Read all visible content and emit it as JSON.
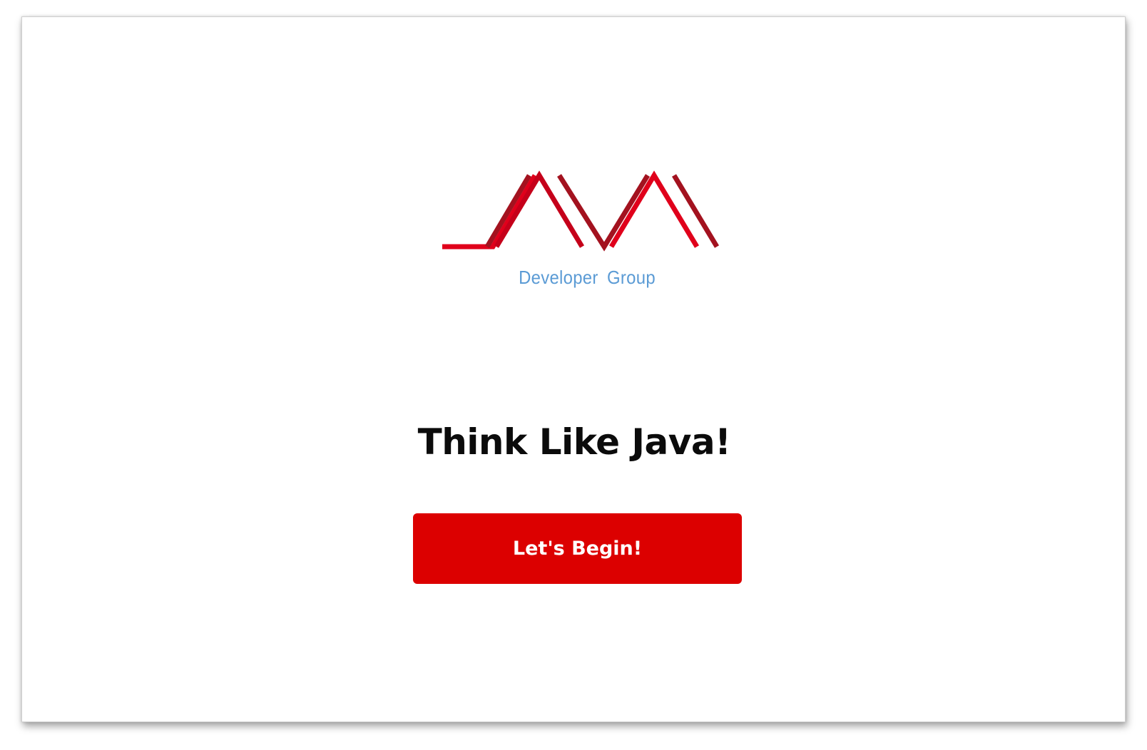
{
  "logo": {
    "wordmark": "JAVA",
    "subtitle": "Developer Group",
    "colors": {
      "red": "#e0001b",
      "dark_red": "#a3121f",
      "blue": "#5b9bd5"
    }
  },
  "main": {
    "title": "Think Like Java!",
    "cta_label": "Let's Begin!"
  },
  "theme": {
    "accent": "#dc0000",
    "background": "#ffffff",
    "text": "#0b0b0b"
  }
}
